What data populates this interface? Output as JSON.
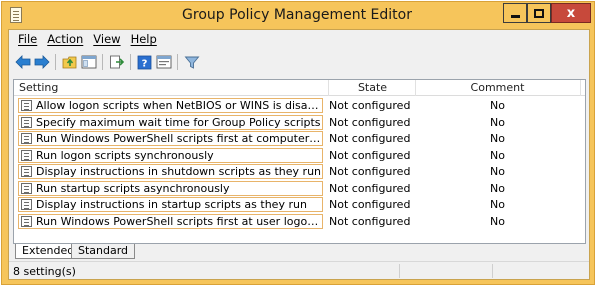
{
  "window": {
    "title": "Group Policy Management Editor",
    "close_glyph": "x"
  },
  "menubar": {
    "items": [
      {
        "label": "File"
      },
      {
        "label": "Action"
      },
      {
        "label": "View"
      },
      {
        "label": "Help"
      }
    ]
  },
  "toolbar": {
    "icons": [
      "back-icon",
      "forward-icon",
      "up-folder-icon",
      "show-hide-tree-icon",
      "export-list-icon",
      "help-icon",
      "properties-icon",
      "filter-icon"
    ]
  },
  "list": {
    "columns": {
      "setting": "Setting",
      "state": "State",
      "comment": "Comment"
    },
    "rows": [
      {
        "setting": "Allow logon scripts when NetBIOS or WINS is disabled",
        "state": "Not configured",
        "comment": "No"
      },
      {
        "setting": "Specify maximum wait time for Group Policy scripts",
        "state": "Not configured",
        "comment": "No"
      },
      {
        "setting": "Run Windows PowerShell scripts first at computer startup, s...",
        "state": "Not configured",
        "comment": "No"
      },
      {
        "setting": "Run logon scripts synchronously",
        "state": "Not configured",
        "comment": "No"
      },
      {
        "setting": "Display instructions in shutdown scripts as they run",
        "state": "Not configured",
        "comment": "No"
      },
      {
        "setting": "Run startup scripts asynchronously",
        "state": "Not configured",
        "comment": "No"
      },
      {
        "setting": "Display instructions in startup scripts as they run",
        "state": "Not configured",
        "comment": "No"
      },
      {
        "setting": "Run Windows PowerShell scripts first at user logon, logoff",
        "state": "Not configured",
        "comment": "No"
      }
    ]
  },
  "tabs": {
    "extended": "Extended",
    "standard": "Standard"
  },
  "status": {
    "text": "8 setting(s)"
  },
  "colors": {
    "title_bar": "#f6c55b",
    "close_button": "#c7493b",
    "row_border": "#e8b46a"
  }
}
